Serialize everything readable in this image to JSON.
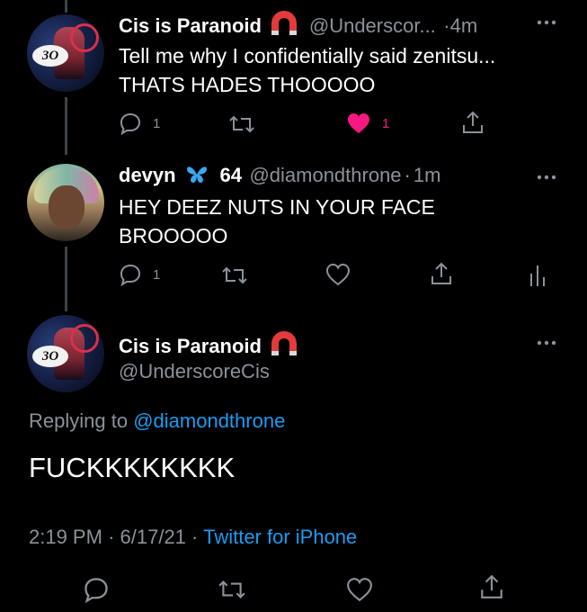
{
  "tweet1": {
    "author_name": "Cis is Paranoid",
    "handle": "@Underscor...",
    "separator": "·",
    "time": "4m",
    "text_line1": "Tell me why I confidentially said zenitsu...",
    "text_line2": "THATS HADES THOOOOO",
    "reply_count": "1",
    "like_count": "1",
    "avatar_badge": "3O"
  },
  "tweet2": {
    "author_name": "devyn",
    "emoji_icon": "butterfly-icon",
    "name_suffix": "64",
    "handle": "@diamondthrone",
    "separator": "·",
    "time": "1m",
    "text_line1": "HEY DEEZ NUTS IN YOUR FACE",
    "text_line2": "BROOOOO",
    "reply_count": "1"
  },
  "main_tweet": {
    "author_name": "Cis is Paranoid",
    "handle": "@UnderscoreCis",
    "replying_prefix": "Replying to",
    "replying_handle": "@diamondthrone",
    "text": "FUCKKKKKKKK",
    "time": "2:19 PM",
    "sep1": "·",
    "date": "6/17/21",
    "sep2": "·",
    "source": "Twitter for iPhone",
    "avatar_badge": "3O"
  },
  "colors": {
    "background": "#000000",
    "secondary_text": "#8b9299",
    "link": "#1d9bf0",
    "like": "#f91880",
    "magnet": "#e23b3b"
  }
}
